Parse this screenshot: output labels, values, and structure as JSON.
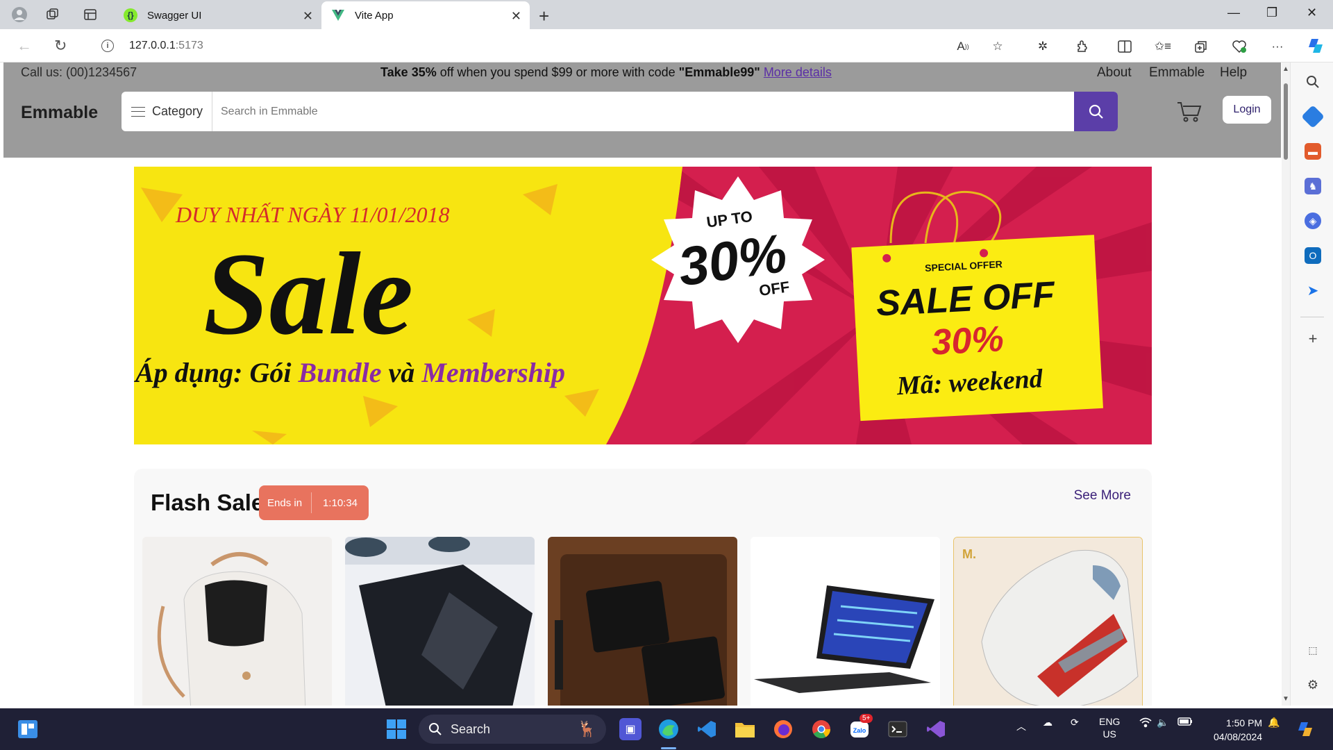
{
  "browser": {
    "tabs": [
      {
        "title": "Swagger UI",
        "active": false
      },
      {
        "title": "Vite App",
        "active": true
      }
    ],
    "url_host": "127.0.0.1",
    "url_port": ":5173"
  },
  "site": {
    "phone": "Call us: (00)1234567",
    "promo": {
      "take": "Take",
      "percent": "35%",
      "mid": "off when you spend $99 or more with code",
      "code": "\"Emmable99\"",
      "link": "More details"
    },
    "top_links": [
      "About",
      "Emmable",
      "Help"
    ],
    "brand": "Emmable",
    "category_label": "Category",
    "search_placeholder": "Search in Emmable",
    "login": "Login"
  },
  "banner": {
    "date_line": "DUY NHẤT NGÀY 11/01/2018",
    "headline": "Sale",
    "subline_a": "Áp dụng: Gói",
    "subline_b": "Bundle",
    "subline_c": "và",
    "subline_d": "Membership",
    "burst_top": "UP TO",
    "burst_value": "30%",
    "burst_bottom": "OFF",
    "bag_small": "SPECIAL OFFER",
    "bag_main": "SALE OFF",
    "bag_value": "30%",
    "bag_code": "Mã: weekend"
  },
  "flash_sale": {
    "title": "Flash Sale",
    "ends_label": "Ends in",
    "countdown": "1:10:34",
    "see_more": "See More",
    "products": [
      "backpack",
      "leather-folio",
      "wallet",
      "tablet-keyboard",
      "sneaker"
    ]
  },
  "taskbar": {
    "search": "Search",
    "lang": "ENG",
    "region": "US",
    "time": "1:50 PM",
    "date": "04/08/2024",
    "badge": "5+"
  },
  "colors": {
    "header_bg": "#9b9b9b",
    "accent": "#5b3ea8",
    "countdown": "#e8735e",
    "banner_yellow": "#f7e511",
    "banner_red": "#d41f4e"
  }
}
